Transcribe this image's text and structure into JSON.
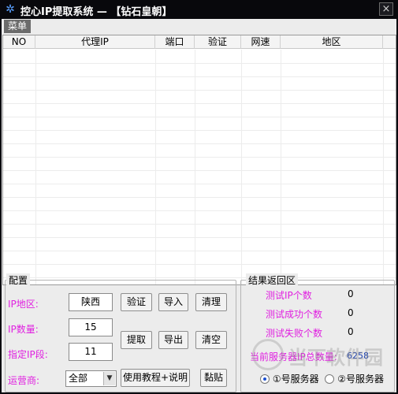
{
  "window": {
    "title": "控心IP提取系统 — 【钻石皇朝】",
    "close_glyph": "×",
    "app_icon": "snowflake-icon"
  },
  "menu": {
    "items": [
      "菜单"
    ]
  },
  "grid": {
    "columns": [
      "NO",
      "代理IP",
      "端口",
      "验证",
      "网速",
      "地区"
    ]
  },
  "config": {
    "title": "配置",
    "region_label": "IP地区:",
    "region_value": "陕西",
    "count_label": "IP数量:",
    "count_value": "15",
    "segment_label": "指定IP段:",
    "segment_value": "11",
    "carrier_label": "运营商:",
    "carrier_value": "全部",
    "buttons": {
      "verify": "验证",
      "import": "导入",
      "clear": "清理",
      "extract": "提取",
      "export": "导出",
      "empty": "清空",
      "tutorial": "使用教程+说明",
      "paste": "黏贴"
    }
  },
  "results": {
    "title": "结果返回区",
    "tested_label": "测试IP个数",
    "tested_value": "0",
    "success_label": "测试成功个数",
    "success_value": "0",
    "failed_label": "测试失败个数",
    "failed_value": "0",
    "total_label": "当前服务器IP总数量:",
    "total_value": "6258",
    "server1": "①号服务器",
    "server2": "②号服务器",
    "selected_server": "server1"
  },
  "watermark": {
    "text": "当下软件园"
  },
  "colors": {
    "label_magenta": "#e020e0",
    "title_bar": "#08080c",
    "client_bg": "#ececec",
    "total_blue": "#1a3fb0"
  }
}
